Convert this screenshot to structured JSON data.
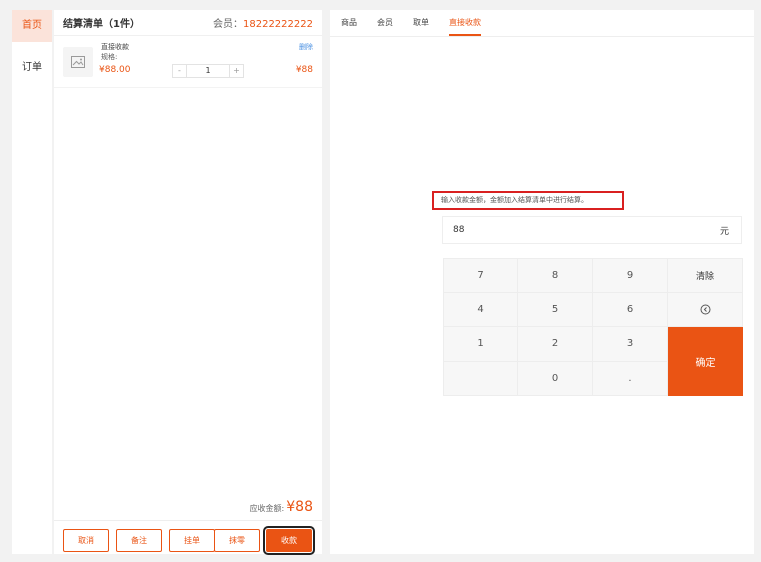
{
  "nav": {
    "items": [
      {
        "label": "首页",
        "active": true
      },
      {
        "label": "订单",
        "active": false
      }
    ]
  },
  "cart": {
    "title": "结算清单（1件）",
    "member_label": "会员：",
    "member_phone": "18222222222",
    "item": {
      "name": "直接收款",
      "spec": "规格:",
      "price": "¥88.00",
      "quantity": "1",
      "delete_label": "删除",
      "total": "¥88",
      "image_icon": "image-placeholder-icon"
    },
    "receivable_label": "应收金额:",
    "receivable_amount": "¥88",
    "actions": {
      "cancel": "取消",
      "remark": "备注",
      "hold": "挂单",
      "round_off": "抹零",
      "collect": "收款"
    }
  },
  "tabs": [
    {
      "label": "商品",
      "active": false
    },
    {
      "label": "会员",
      "active": false
    },
    {
      "label": "取单",
      "active": false
    },
    {
      "label": "直接收款",
      "active": true
    }
  ],
  "direct_payment": {
    "hint": "输入收款金额，金额加入结算清单中进行结算。",
    "amount_value": "88",
    "currency_unit": "元",
    "keys": {
      "k7": "7",
      "k8": "8",
      "k9": "9",
      "clear": "清除",
      "k4": "4",
      "k5": "5",
      "k6": "6",
      "backspace_icon": "backspace-icon",
      "k1": "1",
      "k2": "2",
      "k3": "3",
      "confirm": "确定",
      "k0": "0",
      "dot": "."
    }
  },
  "colors": {
    "accent": "#ea5414",
    "highlight_box": "#d92020",
    "link": "#4a90e2"
  }
}
